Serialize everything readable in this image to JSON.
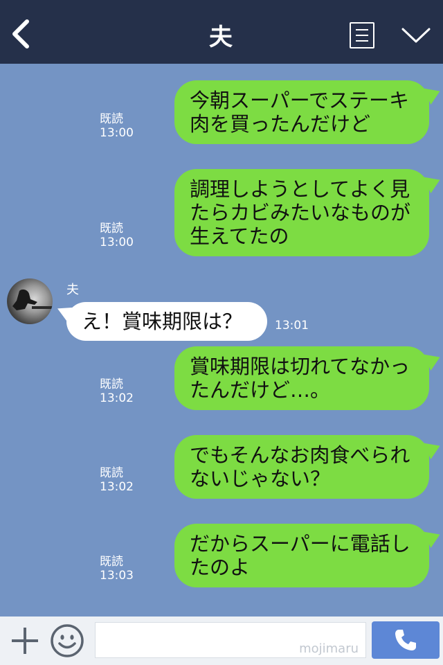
{
  "header": {
    "title": "夫",
    "back_icon": "chevron-left-icon",
    "menu_icon": "menu-list-icon",
    "expand_icon": "chevron-down-icon",
    "bg_color": "#25304a"
  },
  "chat": {
    "bg_color": "#7494c4",
    "outgoing_bubble_color": "#7ddc43",
    "incoming_bubble_color": "#ffffff",
    "messages": [
      {
        "side": "out",
        "text": "今朝スーパーでステーキ肉を買ったんだけど",
        "read": "既読",
        "time": "13:00"
      },
      {
        "side": "out",
        "text": "調理しようとしてよく見たらカビみたいなものが生えてたの",
        "read": "既読",
        "time": "13:00"
      },
      {
        "side": "in",
        "sender": "夫",
        "text": "え！賞味期限は？",
        "time": "13:01"
      },
      {
        "side": "out",
        "text": "賞味期限は切れてなかったんだけど…。",
        "read": "既読",
        "time": "13:02"
      },
      {
        "side": "out",
        "text": "でもそんなお肉食べられないじゃない？",
        "read": "既読",
        "time": "13:02"
      },
      {
        "side": "out",
        "text": "だからスーパーに電話したのよ",
        "read": "既読",
        "time": "13:03"
      }
    ]
  },
  "footer": {
    "plus_icon": "plus-icon",
    "emoji_icon": "smiley-icon",
    "input_value": "",
    "watermark": "mojimaru",
    "call_icon": "phone-icon",
    "call_color": "#5d87d6"
  }
}
